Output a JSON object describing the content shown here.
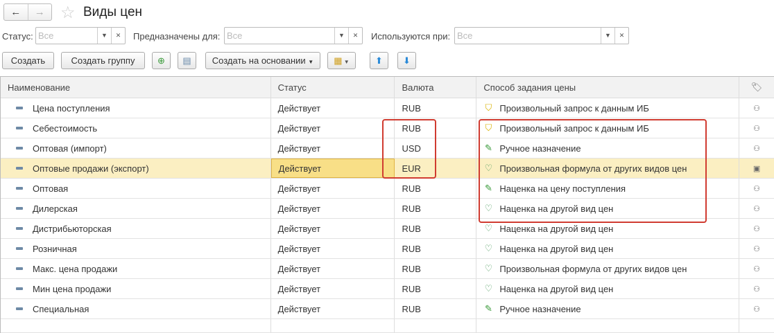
{
  "header": {
    "title": "Виды цен",
    "back": "←",
    "forward": "→"
  },
  "filters": [
    {
      "label": "Статус:",
      "value": "Все"
    },
    {
      "label": "Предназначены для:",
      "value": "Все"
    },
    {
      "label": "Используются при:",
      "value": "Все"
    }
  ],
  "toolbar": {
    "create": "Создать",
    "create_group": "Создать группу",
    "create_based": "Создать на основании"
  },
  "table": {
    "columns": [
      "Наименование",
      "Статус",
      "Валюта",
      "Способ задания цены"
    ],
    "rows": [
      {
        "name": "Цена поступления",
        "status": "Действует",
        "currency": "RUB",
        "method": "Произвольный запрос к данным ИБ",
        "mtype": "q"
      },
      {
        "name": "Себестоимость",
        "status": "Действует",
        "currency": "RUB",
        "method": "Произвольный запрос к данным ИБ",
        "mtype": "q"
      },
      {
        "name": "Оптовая (импорт)",
        "status": "Действует",
        "currency": "USD",
        "method": "Ручное назначение",
        "mtype": "m"
      },
      {
        "name": "Оптовые продажи (экспорт)",
        "status": "Действует",
        "currency": "EUR",
        "method": "Произвольная формула от других видов цен",
        "mtype": "f",
        "selected": true
      },
      {
        "name": "Оптовая",
        "status": "Действует",
        "currency": "RUB",
        "method": "Наценка на цену поступления",
        "mtype": "m"
      },
      {
        "name": "Дилерская",
        "status": "Действует",
        "currency": "RUB",
        "method": "Наценка на другой вид цен",
        "mtype": "f"
      },
      {
        "name": "Дистрибьюторская",
        "status": "Действует",
        "currency": "RUB",
        "method": "Наценка на другой вид цен",
        "mtype": "f"
      },
      {
        "name": "Розничная",
        "status": "Действует",
        "currency": "RUB",
        "method": "Наценка на другой вид цен",
        "mtype": "f"
      },
      {
        "name": "Макс. цена продажи",
        "status": "Действует",
        "currency": "RUB",
        "method": "Произвольная формула от других видов цен",
        "mtype": "f"
      },
      {
        "name": "Мин цена продажи",
        "status": "Действует",
        "currency": "RUB",
        "method": "Наценка на другой вид цен",
        "mtype": "f"
      },
      {
        "name": "Специальная",
        "status": "Действует",
        "currency": "RUB",
        "method": "Ручное назначение",
        "mtype": "m"
      }
    ]
  }
}
